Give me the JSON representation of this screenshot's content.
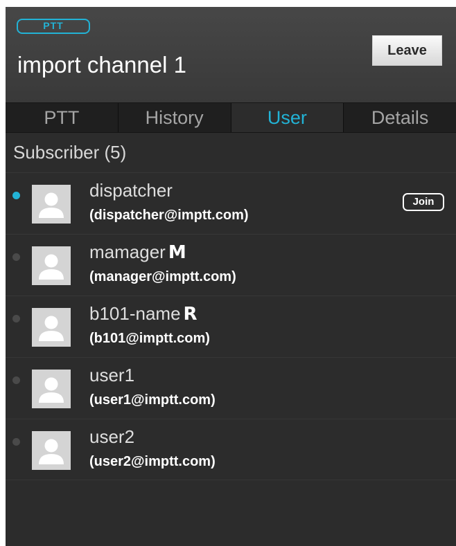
{
  "header": {
    "badge": "PTT",
    "channel_title": "import channel 1",
    "leave_label": "Leave"
  },
  "tabs": [
    {
      "label": "PTT",
      "active": false
    },
    {
      "label": "History",
      "active": false
    },
    {
      "label": "User",
      "active": true
    },
    {
      "label": "Details",
      "active": false
    }
  ],
  "section": {
    "title": "Subscriber (5)"
  },
  "subscribers": [
    {
      "name": "dispatcher",
      "role": "",
      "email": "(dispatcher@imptt.com)",
      "online": true,
      "join_label": "Join"
    },
    {
      "name": "mamager",
      "role": "M",
      "email": "(manager@imptt.com)",
      "online": false
    },
    {
      "name": "b101-name",
      "role": "R",
      "email": "(b101@imptt.com)",
      "online": false
    },
    {
      "name": "user1",
      "role": "",
      "email": "(user1@imptt.com)",
      "online": false
    },
    {
      "name": "user2",
      "role": "",
      "email": "(user2@imptt.com)",
      "online": false
    }
  ],
  "colors": {
    "accent": "#22b3d6",
    "background": "#2c2c2c",
    "header": "#404040"
  },
  "icons": {
    "avatar": "user-avatar-icon",
    "status": "status-dot-icon"
  }
}
